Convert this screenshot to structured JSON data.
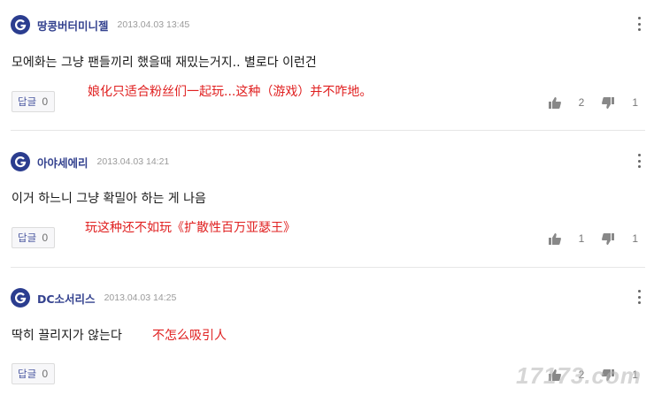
{
  "comments": [
    {
      "author": "땅콩버터미니젤",
      "time": "2013.04.03 13:45",
      "text": "모에화는 그냥 팬들끼리 했을때 재밌는거지.. 별로다 이런건",
      "annotation": "娘化只适合粉丝们一起玩...这种（游戏）并不咋地。",
      "reply_label": "답글",
      "reply_count": "0",
      "likes": "2",
      "dislikes": "1"
    },
    {
      "author": "아야세에리",
      "time": "2013.04.03 14:21",
      "text": "이거 하느니 그냥 확밀아 하는 게 나음",
      "annotation": "玩这种还不如玩《扩散性百万亚瑟王》",
      "reply_label": "답글",
      "reply_count": "0",
      "likes": "1",
      "dislikes": "1"
    },
    {
      "author": "DC소서리스",
      "time": "2013.04.03 14:25",
      "text": "딱히 끌리지가 않는다",
      "annotation": "不怎么吸引人",
      "reply_label": "답글",
      "reply_count": "0",
      "likes": "2",
      "dislikes": "1"
    }
  ],
  "watermark": "17173.com",
  "colors": {
    "author": "#34428f",
    "avatar": "#2b3d8f",
    "annotation": "#e02020",
    "timestamp": "#9a9a9a"
  },
  "icons": [
    "avatar-g-icon",
    "more-vertical-icon",
    "thumbs-up-icon",
    "thumbs-down-icon"
  ]
}
